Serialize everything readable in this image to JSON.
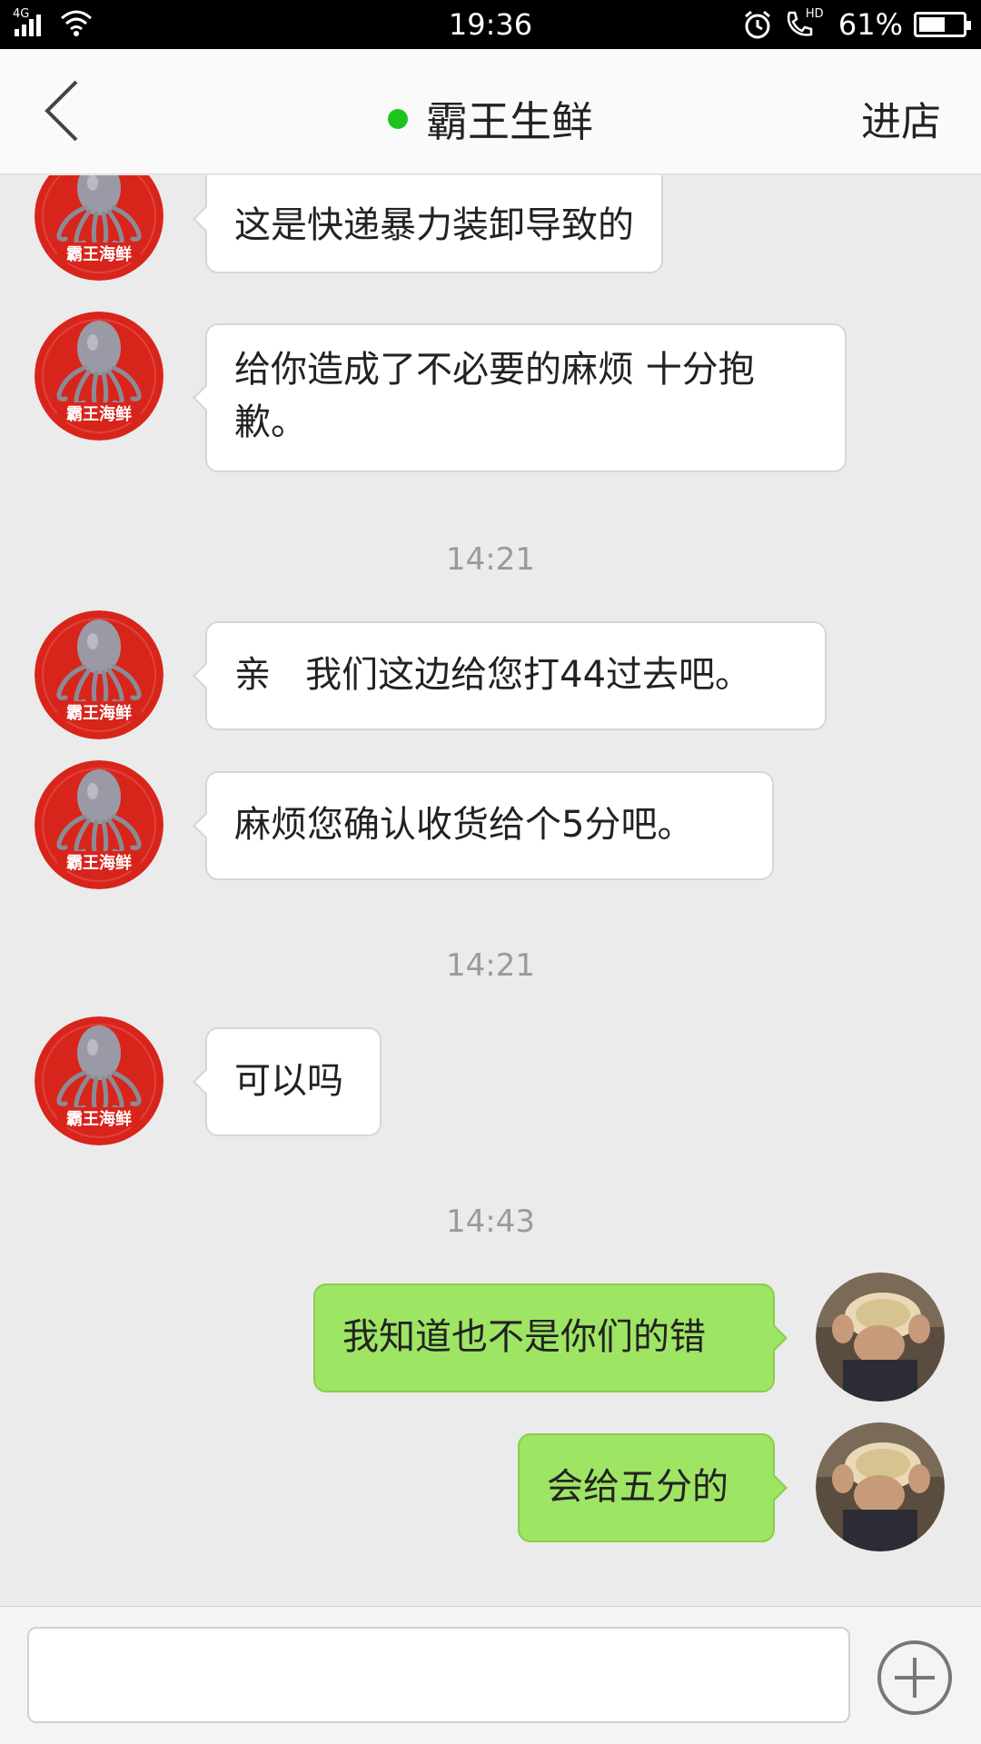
{
  "status_bar": {
    "network": "4G",
    "time": "19:36",
    "call_badge": "HD",
    "battery_percent_label": "61%",
    "battery_level": 0.61
  },
  "header": {
    "title": "霸王生鲜",
    "shop_link": "进店",
    "online_color": "#1ec41e"
  },
  "avatars": {
    "shop_avatar_text": "霸王海鲜"
  },
  "chat": {
    "messages": [
      {
        "side": "in",
        "text": "这是快递暴力装卸导致的"
      },
      {
        "side": "in",
        "text": "给你造成了不必要的麻烦  十分抱歉。"
      },
      {
        "side": "in",
        "text": "亲   我们这边给您打44过去吧。"
      },
      {
        "side": "in",
        "text": "麻烦您确认收货给个5分吧。"
      },
      {
        "side": "in",
        "text": "可以吗"
      },
      {
        "side": "out",
        "text": "我知道也不是你们的错"
      },
      {
        "side": "out",
        "text": "会给五分的"
      }
    ],
    "timestamps": [
      "14:21",
      "14:21",
      "14:43"
    ]
  },
  "colors": {
    "outgoing_bubble": "#9ee564",
    "incoming_bubble": "#ffffff",
    "chat_background": "#ebebeb",
    "shop_avatar_red": "#d8251c"
  },
  "input": {
    "value": "",
    "placeholder": ""
  }
}
